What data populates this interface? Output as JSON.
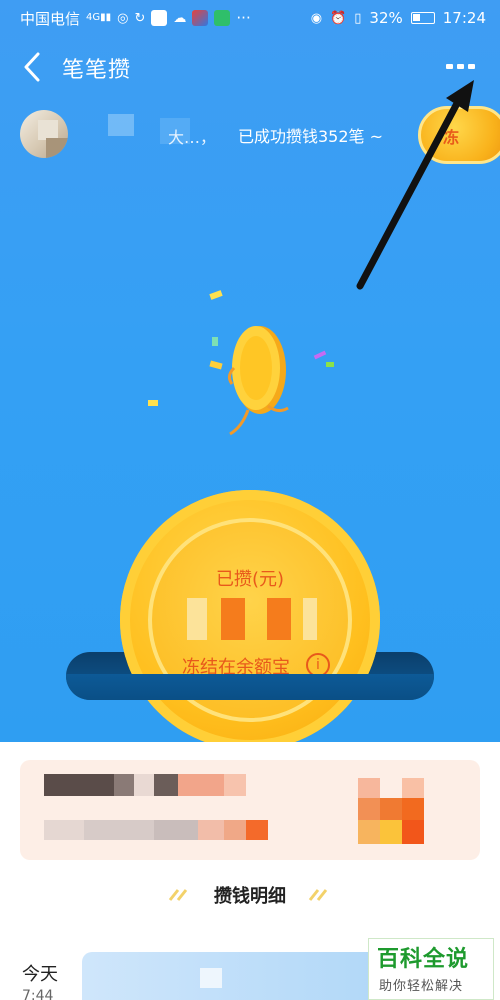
{
  "status_bar": {
    "carrier": "中国电信",
    "network": "4G",
    "battery": "32%",
    "time": "17:24",
    "dots": "···"
  },
  "nav": {
    "title": "笔笔攒",
    "back_icon": "chevron-left-icon",
    "more_icon": "more-dots-icon"
  },
  "user": {
    "name_visible": "大…，",
    "message": "已成功攒钱352笔 ~",
    "unfreeze_label": "冻"
  },
  "coin": {
    "saved_label": "已攒(元)",
    "freeze_label": "冻结在余额宝",
    "info_icon": "info-icon",
    "info_glyph": "i"
  },
  "details": {
    "section_title": "攒钱明细",
    "today_label": "今天",
    "time": "7:44"
  },
  "watermark": {
    "top": "百科全说",
    "bottom": "助你轻松解决"
  },
  "colors": {
    "hero_blue": "#3a9ff3",
    "coin_gold": "#ffc21f",
    "coin_text": "#e8591b",
    "watermark_green": "#1e9a2e"
  }
}
